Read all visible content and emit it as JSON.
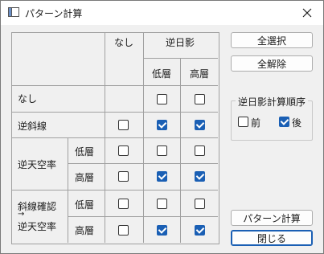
{
  "window": {
    "title": "パターン計算",
    "close_label": "✕"
  },
  "table": {
    "header": {
      "none": "なし",
      "reverse_shadow": "逆日影",
      "low": "低層",
      "high": "高層"
    },
    "rows": {
      "none": "なし",
      "reverse_slope": "逆斜線",
      "reverse_sky": "逆天空率",
      "slope_check": "斜線確認",
      "arrow": "→",
      "slope_sky": "逆天空率",
      "low": "低層",
      "high": "高層"
    },
    "checks": {
      "none_low": false,
      "none_high": false,
      "slope_none": false,
      "slope_low": true,
      "slope_high": true,
      "sky_low_none": false,
      "sky_low_low": false,
      "sky_low_high": false,
      "sky_high_none": false,
      "sky_high_low": true,
      "sky_high_high": true,
      "check_low_none": false,
      "check_low_low": false,
      "check_low_high": false,
      "check_high_none": false,
      "check_high_low": true,
      "check_high_high": true
    }
  },
  "buttons": {
    "select_all": "全選択",
    "deselect_all": "全解除",
    "calc": "パターン計算",
    "close": "閉じる"
  },
  "order_group": {
    "title": "逆日影計算順序",
    "before": "前",
    "after": "後",
    "before_checked": false,
    "after_checked": true
  },
  "colors": {
    "accent": "#1a5fb4"
  }
}
